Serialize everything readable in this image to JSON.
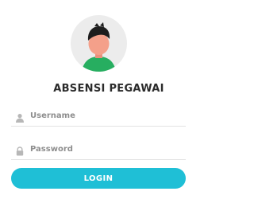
{
  "login": {
    "avatar_icon": "user-avatar-icon",
    "title": "ABSENSI PEGAWAI",
    "username": {
      "placeholder": "Username",
      "value": "",
      "icon": "person-icon"
    },
    "password": {
      "placeholder": "Password",
      "value": "",
      "icon": "lock-icon"
    },
    "login_label": "LOGIN"
  },
  "colors": {
    "accent": "#1fbfd6",
    "avatar_bg": "#ececec",
    "avatar_shirt": "#27ae60",
    "avatar_skin": "#f4a08a"
  }
}
